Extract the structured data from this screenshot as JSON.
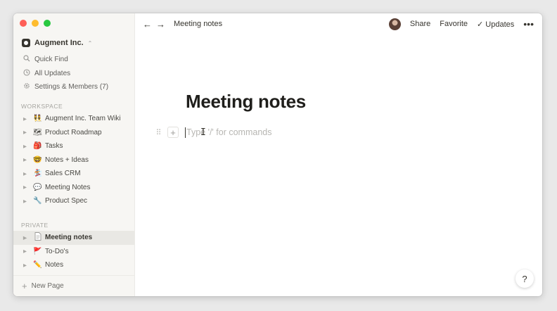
{
  "app": {
    "window_title": "Meeting notes"
  },
  "sidebar": {
    "workspace_name": "Augment Inc.",
    "nav": [
      {
        "label": "Quick Find",
        "icon": "search-icon"
      },
      {
        "label": "All Updates",
        "icon": "clock-icon"
      },
      {
        "label": "Settings & Members (7)",
        "icon": "gear-icon"
      }
    ],
    "workspace_label": "WORKSPACE",
    "workspace_pages": [
      {
        "label": "Augment Inc. Team Wiki",
        "emoji": "👯"
      },
      {
        "label": "Product Roadmap",
        "emoji": "🗺"
      },
      {
        "label": "Tasks",
        "emoji": "🎒"
      },
      {
        "label": "Notes + Ideas",
        "emoji": "🤓"
      },
      {
        "label": "Sales CRM",
        "emoji": "🏂"
      },
      {
        "label": "Meeting Notes",
        "emoji": "💬"
      },
      {
        "label": "Product Spec",
        "emoji": "🔧"
      }
    ],
    "private_label": "PRIVATE",
    "private_pages": [
      {
        "label": "Meeting notes",
        "emoji": "📄",
        "active": true
      },
      {
        "label": "To-Do's",
        "emoji": "🚩"
      },
      {
        "label": "Notes",
        "emoji": "✏️"
      }
    ],
    "new_page_label": "New Page"
  },
  "topbar": {
    "back_icon": "←",
    "forward_icon": "→",
    "breadcrumb": "Meeting notes",
    "share_label": "Share",
    "favorite_label": "Favorite",
    "updates_check": "✓",
    "updates_label": "Updates",
    "more_icon": "•••"
  },
  "page": {
    "title": "Meeting notes",
    "placeholder": "Type '/' for commands",
    "drag_glyph": "⠿",
    "add_glyph": "+"
  },
  "help": {
    "label": "?"
  },
  "colors": {
    "sidebar_bg": "#f7f6f3",
    "active_row": "#e9e8e4",
    "text": "#37352f"
  }
}
